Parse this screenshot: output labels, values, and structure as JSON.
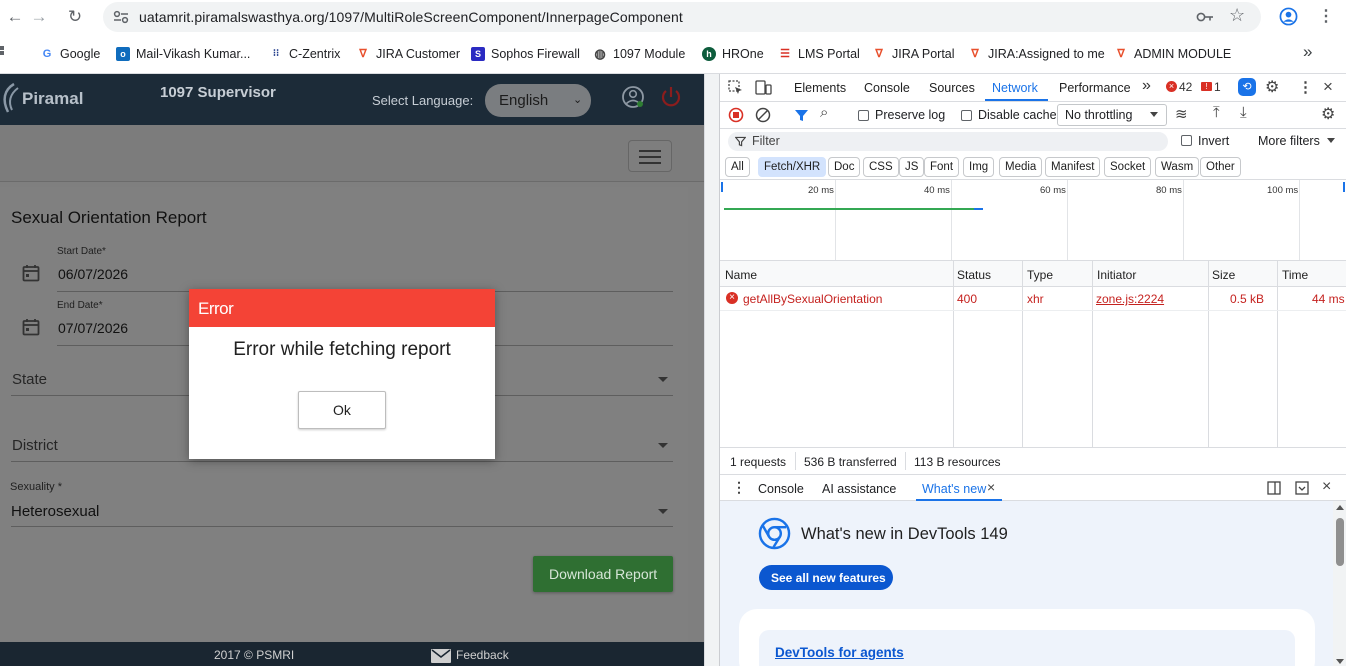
{
  "browser": {
    "url": "uatamrit.piramalswasthya.org/1097/MultiRoleScreenComponent/InnerpageComponent",
    "bookmarks": [
      {
        "label": "Google",
        "icon": "google-icon"
      },
      {
        "label": "Mail-Vikash Kumar...",
        "icon": "mail-icon"
      },
      {
        "label": "C-Zentrix",
        "icon": "czentrix-icon"
      },
      {
        "label": "JIRA Customer",
        "icon": "jira-icon"
      },
      {
        "label": "Sophos Firewall",
        "icon": "sophos-icon"
      },
      {
        "label": "1097 Module",
        "icon": "globe-icon"
      },
      {
        "label": "HROne",
        "icon": "hrone-icon"
      },
      {
        "label": "LMS Portal",
        "icon": "lms-icon"
      },
      {
        "label": "JIRA Portal",
        "icon": "jira-icon"
      },
      {
        "label": "JIRA:Assigned to me",
        "icon": "jira-icon"
      },
      {
        "label": "ADMIN MODULE",
        "icon": "admin-icon"
      }
    ],
    "more_bookmarks": "»"
  },
  "app": {
    "logo_text": "Piramal",
    "title": "1097 Supervisor",
    "language_label": "Select Language:",
    "language_value": "English",
    "report": {
      "title": "Sexual Orientation Report",
      "start_date_label": "Start Date*",
      "start_date_value": "06/07/2026",
      "end_date_label": "End Date*",
      "end_date_value": "07/07/2026",
      "state_placeholder": "State",
      "district_placeholder": "District",
      "sexuality_label": "Sexuality *",
      "sexuality_value": "Heterosexual",
      "download_label": "Download Report"
    },
    "footer": {
      "copyright": "2017 © PSMRI",
      "feedback": "Feedback"
    },
    "dialog": {
      "title": "Error",
      "message": "Error while fetching report",
      "ok_label": "Ok"
    }
  },
  "devtools": {
    "tabs": [
      "Elements",
      "Console",
      "Sources",
      "Network",
      "Performance"
    ],
    "active_tab": "Network",
    "more_tabs": "»",
    "error_count": "42",
    "warning_count": "1",
    "preserve_log": "Preserve log",
    "disable_cache": "Disable cache",
    "throttling": "No throttling",
    "filter_placeholder": "Filter",
    "invert": "Invert",
    "more_filters": "More filters",
    "type_filters": [
      "All",
      "Fetch/XHR",
      "Doc",
      "CSS",
      "JS",
      "Font",
      "Img",
      "Media",
      "Manifest",
      "Socket",
      "Wasm",
      "Other"
    ],
    "active_filter": "Fetch/XHR",
    "timeline_ticks": [
      "20 ms",
      "40 ms",
      "60 ms",
      "80 ms",
      "100 ms"
    ],
    "columns": [
      "Name",
      "Status",
      "Type",
      "Initiator",
      "Size",
      "Time"
    ],
    "rows": [
      {
        "name": "getAllBySexualOrientation",
        "status": "400",
        "type": "xhr",
        "initiator": "zone.js:2224",
        "size": "0.5 kB",
        "time": "44 ms"
      }
    ],
    "summary": {
      "requests": "1 requests",
      "transferred": "536 B transferred",
      "resources": "113 B resources"
    },
    "drawer_tabs": [
      "Console",
      "AI assistance",
      "What's new"
    ],
    "drawer_active": "What's new",
    "whats_new_title": "What's new in DevTools 149",
    "see_all": "See all new features",
    "card_link": "DevTools for agents"
  },
  "colors": {
    "app_header": "#1c2b38",
    "dialog_header": "#f44336",
    "download_button": "#43a047",
    "devtools_accent": "#1a73e8",
    "error_red": "#c5221f"
  }
}
